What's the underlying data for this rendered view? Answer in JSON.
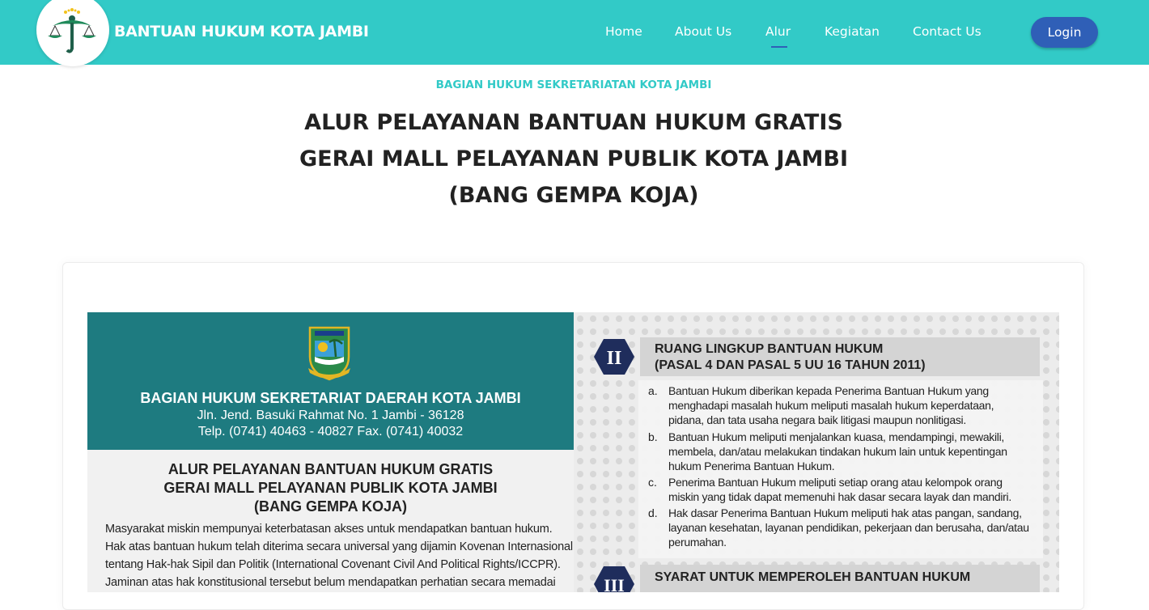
{
  "nav": {
    "brand": "BANTUAN HUKUM KOTA JAMBI",
    "items": [
      {
        "label": "Home"
      },
      {
        "label": "About Us"
      },
      {
        "label": "Alur"
      },
      {
        "label": "Kegiatan"
      },
      {
        "label": "Contact Us"
      }
    ],
    "active_item": "Alur",
    "login_label": "Login"
  },
  "page": {
    "subtitle": "BAGIAN HUKUM SEKRETARIATAN KOTA JAMBI",
    "title_lines": [
      "ALUR PELAYANAN BANTUAN HUKUM GRATIS",
      "GERAI MALL PELAYANAN PUBLIK KOTA JAMBI",
      "(BANG GEMPA KOJA)"
    ]
  },
  "poster": {
    "crest_label": "KOTA JAMBI",
    "org_name": "BAGIAN HUKUM SEKRETARIAT DAERAH KOTA JAMBI",
    "address": "Jln. Jend. Basuki Rahmat No. 1 Jambi - 36128",
    "phone": "Telp. (0741) 40463 - 40827 Fax. (0741) 40032",
    "title_lines": [
      "ALUR PELAYANAN BANTUAN HUKUM GRATIS",
      "GERAI MALL PELAYANAN PUBLIK KOTA JAMBI",
      "(BANG GEMPA KOJA)"
    ],
    "body_lines": [
      "Masyarakat miskin mempunyai keterbatasan akses untuk mendapatkan bantuan hukum.",
      "Hak atas bantuan hukum telah diterima secara universal yang dijamin Kovenan Internasional",
      "tentang Hak-hak Sipil dan Politik (International Covenant Civil And Political Rights/ICCPR).",
      "Jaminan atas hak konstitusional tersebut belum mendapatkan perhatian secara memadai"
    ],
    "section2": {
      "number": "II",
      "title_lines": [
        "RUANG LINGKUP BANTUAN HUKUM",
        "(PASAL 4 DAN PASAL 5 UU 16 TAHUN 2011)"
      ],
      "items": [
        {
          "mark": "a.",
          "lines": [
            "Bantuan Hukum diberikan kepada Penerima Bantuan Hukum yang",
            "menghadapi masalah hukum meliputi masalah hukum keperdataan,",
            "pidana, dan tata usaha negara baik litigasi maupun nonlitigasi."
          ]
        },
        {
          "mark": "b.",
          "lines": [
            "Bantuan Hukum meliputi menjalankan kuasa, mendampingi, mewakili,",
            "membela, dan/atau melakukan tindakan hukum lain untuk kepentingan",
            "hukum Penerima Bantuan Hukum."
          ]
        },
        {
          "mark": "c.",
          "lines": [
            "Penerima Bantuan Hukum meliputi setiap orang atau kelompok orang",
            "miskin yang tidak dapat memenuhi hak dasar secara layak dan mandiri."
          ]
        },
        {
          "mark": "d.",
          "lines": [
            "Hak dasar Penerima Bantuan Hukum meliputi hak atas pangan, sandang,",
            "layanan kesehatan, layanan pendidikan, pekerjaan dan berusaha, dan/atau",
            "perumahan."
          ]
        }
      ]
    },
    "section3": {
      "number": "III",
      "title": "SYARAT UNTUK MEMPEROLEH BANTUAN HUKUM"
    }
  },
  "colors": {
    "navbar": "#32cac7",
    "accent": "#2f5fb7",
    "poster_header": "#1e7b80",
    "hex_badge": "#1f2d5c"
  }
}
